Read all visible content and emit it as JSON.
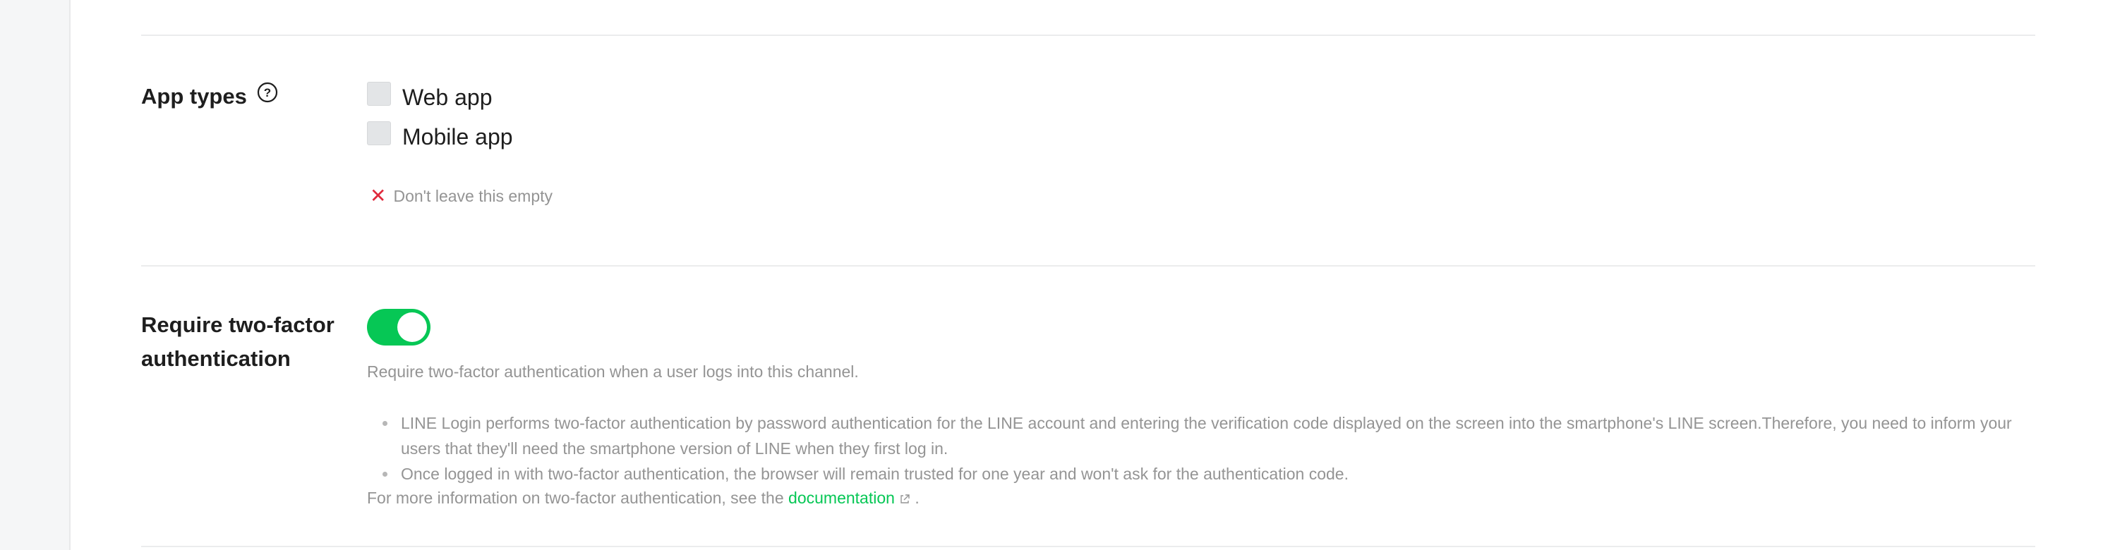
{
  "app_types": {
    "label": "App types",
    "options": [
      {
        "label": "Web app",
        "checked": false
      },
      {
        "label": "Mobile app",
        "checked": false
      }
    ],
    "error": "Don't leave this empty"
  },
  "two_factor": {
    "label_line1": "Require two-factor",
    "label_line2": "authentication",
    "enabled": true,
    "description": "Require two-factor authentication when a user logs into this channel.",
    "bullets": [
      "LINE Login performs two-factor authentication by password authentication for the LINE account and entering the verification code displayed on the screen into the smartphone's LINE screen.Therefore, you need to inform your users that they'll need the smartphone version of LINE when they first log in.",
      "Once logged in with two-factor authentication, the browser will remain trusted for one year and won't ask for the authentication code."
    ],
    "more_info_prefix": "For more information on two-factor authentication, see the",
    "more_info_link": "documentation",
    "more_info_suffix": "."
  },
  "colors": {
    "accent": "#06c755",
    "error": "#e0293c",
    "muted_text": "#949494"
  }
}
